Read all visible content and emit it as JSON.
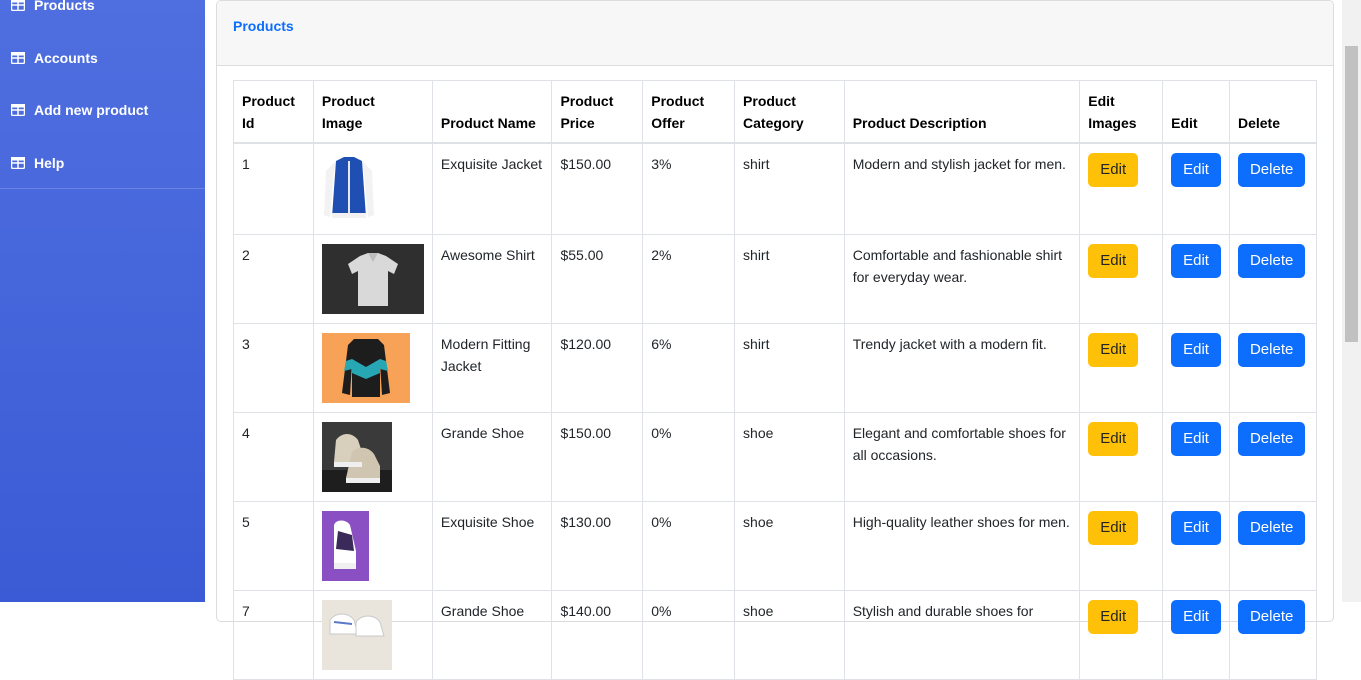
{
  "sidebar": {
    "items": [
      {
        "label": "Products",
        "icon": "table-icon"
      },
      {
        "label": "Accounts",
        "icon": "table-icon"
      },
      {
        "label": "Add new product",
        "icon": "table-icon"
      },
      {
        "label": "Help",
        "icon": "table-icon"
      }
    ]
  },
  "card": {
    "title": "Products"
  },
  "table": {
    "headers": {
      "id": [
        "Product",
        "Id"
      ],
      "image": [
        "Product",
        "Image"
      ],
      "name": "Product Name",
      "price": [
        "Product",
        "Price"
      ],
      "offer": [
        "Product",
        "Offer"
      ],
      "category": [
        "Product",
        "Category"
      ],
      "description": "Product Description",
      "edit_images": [
        "Edit",
        "Images"
      ],
      "edit": "Edit",
      "delete": "Delete"
    },
    "rows": [
      {
        "id": "1",
        "name": "Exquisite Jacket",
        "price": "$150.00",
        "offer": "3%",
        "category": "shirt",
        "description": "Modern and stylish jacket for men.",
        "image": "blue-varsity-jacket"
      },
      {
        "id": "2",
        "name": "Awesome Shirt",
        "price": "$55.00",
        "offer": "2%",
        "category": "shirt",
        "description": "Comfortable and fashionable shirt for everyday wear.",
        "image": "grey-shirt"
      },
      {
        "id": "3",
        "name": "Modern Fitting Jacket",
        "price": "$120.00",
        "offer": "6%",
        "category": "shirt",
        "description": "Trendy jacket with a modern fit.",
        "image": "teal-black-jacket"
      },
      {
        "id": "4",
        "name": "Grande Shoe",
        "price": "$150.00",
        "offer": "0%",
        "category": "shoe",
        "description": "Elegant and comfortable shoes for all occasions.",
        "image": "beige-sneakers"
      },
      {
        "id": "5",
        "name": "Exquisite Shoe",
        "price": "$130.00",
        "offer": "0%",
        "category": "shoe",
        "description": "High-quality leather shoes for men.",
        "image": "purple-sneaker"
      },
      {
        "id": "7",
        "name": "Grande Shoe",
        "price": "$140.00",
        "offer": "0%",
        "category": "shoe",
        "description": "Stylish and durable shoes for",
        "image": "white-sneakers"
      }
    ],
    "buttons": {
      "edit_images": "Edit",
      "edit": "Edit",
      "delete": "Delete"
    }
  },
  "colors": {
    "sidebar": "#4565dc",
    "accent": "#0d6efd",
    "warning": "#ffc107"
  }
}
